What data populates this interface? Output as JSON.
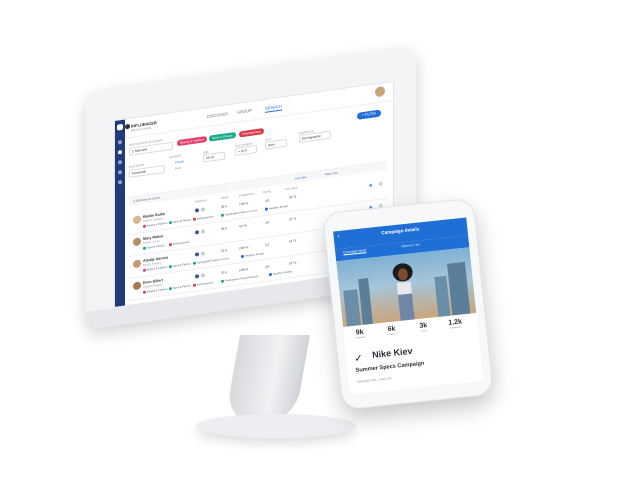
{
  "monitor": {
    "brand_name": "INFLUENCER",
    "brand_sub": "MATCH PANEL",
    "tabs": [
      "DISCOVER",
      "GROUP",
      "SEARCH"
    ],
    "active_tab": "SEARCH",
    "filter_button": "+ FILTER",
    "filters": {
      "influencer_label": "INFLUENCER CATEGORY",
      "influencer_value": "2 Selected",
      "chips": [
        {
          "label": "Beauty & Fashion",
          "color": "#e23d6e"
        },
        {
          "label": "Sport & Fitness",
          "color": "#19a98c"
        },
        {
          "label": "Entertainment",
          "color": "#d93a4a"
        }
      ],
      "platform_label": "PLATFORM",
      "platform_value": "Facebook",
      "gender_label": "GENDER",
      "gender_options": [
        "Female",
        "Male"
      ],
      "age_label": "AGE",
      "age_value": "25-32",
      "followers_label": "FOLLOWERS",
      "followers_value": "> 10 K",
      "city_label": "CITY",
      "city_value": "Izmir",
      "audience_label": "AUDIENCE",
      "audience_value": "Demographic"
    },
    "list_header": {
      "count": "2,456 Results found",
      "view_list": "List view",
      "view_map": "Map view"
    },
    "column_heads": [
      "Networks",
      "Reach",
      "Engagement",
      "Rating",
      "Avg. price"
    ],
    "rows": [
      {
        "name": "Baldin Bullin",
        "sub": "Fashion Designer",
        "reach": "45 K",
        "engagement": "2.59 %",
        "rating": "4.8",
        "price": "18 TL",
        "tags": [
          {
            "label": "Beauty & Fashion",
            "color": "#e23d6e"
          },
          {
            "label": "Sport & Fitness",
            "color": "#19a98c"
          },
          {
            "label": "Entertainment",
            "color": "#d93a4a"
          }
        ],
        "extra_tags": [
          {
            "label": "Sustainable Fashion Lovers",
            "color": "#19a98c"
          },
          {
            "label": "Healthy Lifestyle",
            "color": "#1f6fd6"
          }
        ]
      },
      {
        "name": "Mary Noltes",
        "sub": "Fitness Coach",
        "reach": "30 K",
        "engagement": "4.2 %",
        "rating": "4.6",
        "price": "22 TL",
        "tags": [
          {
            "label": "Sport & Fitness",
            "color": "#19a98c"
          },
          {
            "label": "Entertainment",
            "color": "#d93a4a"
          }
        ],
        "extra_tags": []
      },
      {
        "name": "Aladije Sarona",
        "sub": "Beauty Blogger",
        "reach": "22 K",
        "engagement": "2.06 %",
        "rating": "4.2",
        "price": "14 TL",
        "tags": [
          {
            "label": "Beauty & Fashion",
            "color": "#e23d6e"
          },
          {
            "label": "Sport & Fitness",
            "color": "#19a98c"
          },
          {
            "label": "Sustainable Fashion Lovers",
            "color": "#19a98c"
          }
        ],
        "extra_tags": [
          {
            "label": "Healthy Lifestyle",
            "color": "#1f6fd6"
          }
        ]
      },
      {
        "name": "Esen Gillert",
        "sub": "Lifestyle Blogger",
        "reach": "37 K",
        "engagement": "2.59 %",
        "rating": "4.5",
        "price": "16 TL",
        "tags": [
          {
            "label": "Beauty & Fashion",
            "color": "#e23d6e"
          },
          {
            "label": "Sport & Fitness",
            "color": "#19a98c"
          },
          {
            "label": "Entertainment",
            "color": "#d93a4a"
          }
        ],
        "extra_tags": [
          {
            "label": "Professional Tourist Advisors",
            "color": "#19a98c"
          },
          {
            "label": "Healthy Lifestyle",
            "color": "#1f6fd6"
          }
        ]
      }
    ]
  },
  "phone": {
    "title": "Campaign details",
    "tabs": [
      "Campaign detail",
      "Influencer list"
    ],
    "active_tab": "Campaign detail",
    "stats": [
      {
        "value": "9k",
        "label": "Followers"
      },
      {
        "value": "6k",
        "label": "Views"
      },
      {
        "value": "3k",
        "label": "Likes"
      },
      {
        "value": "1.2k",
        "label": "Comments"
      }
    ],
    "brand": "Nike Kiev",
    "campaign": "Summer Specs Campaign",
    "meta": "Campaign info: 2 days left"
  }
}
